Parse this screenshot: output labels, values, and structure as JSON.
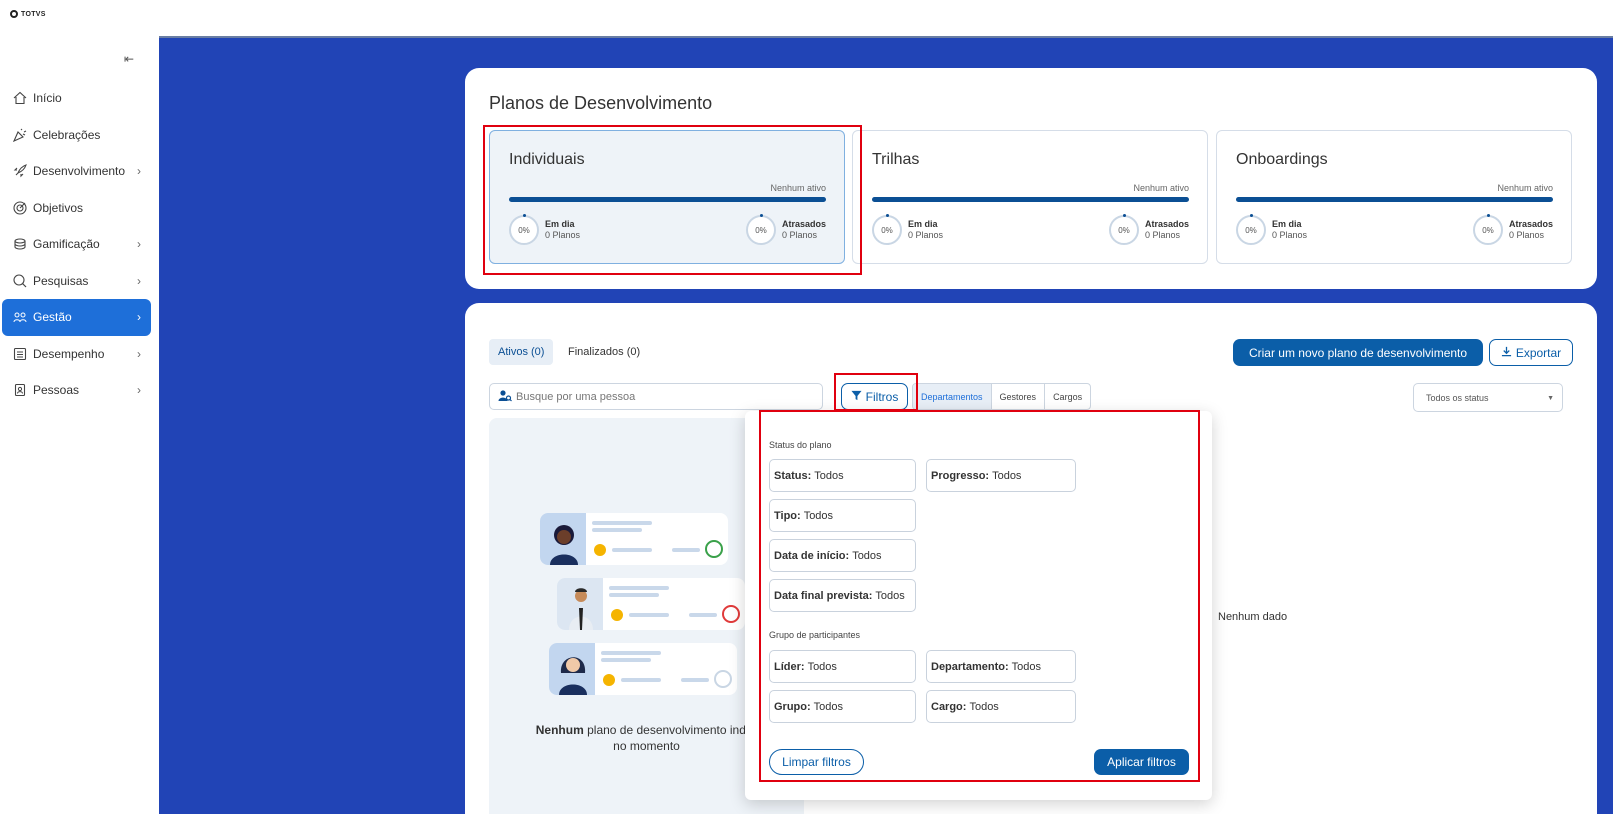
{
  "logo": {
    "text": "TOTVS"
  },
  "sidebar": {
    "collapse_icon": "collapse-left-icon",
    "items": [
      {
        "label": "Início",
        "icon": "home-icon",
        "has_chevron": false,
        "active": false
      },
      {
        "label": "Celebrações",
        "icon": "party-icon",
        "has_chevron": false,
        "active": false
      },
      {
        "label": "Desenvolvimento",
        "icon": "rocket-icon",
        "has_chevron": true,
        "active": false
      },
      {
        "label": "Objetivos",
        "icon": "target-icon",
        "has_chevron": false,
        "active": false
      },
      {
        "label": "Gamificação",
        "icon": "coins-icon",
        "has_chevron": true,
        "active": false
      },
      {
        "label": "Pesquisas",
        "icon": "search-survey-icon",
        "has_chevron": true,
        "active": false
      },
      {
        "label": "Gestão",
        "icon": "team-icon",
        "has_chevron": true,
        "active": true
      },
      {
        "label": "Desempenho",
        "icon": "checklist-icon",
        "has_chevron": true,
        "active": false
      },
      {
        "label": "Pessoas",
        "icon": "badge-icon",
        "has_chevron": true,
        "active": false
      }
    ]
  },
  "summary": {
    "title": "Planos de Desenvolvimento",
    "cards": [
      {
        "title": "Individuais",
        "note": "Nenhum ativo",
        "left": {
          "pct": "0%",
          "label": "Em dia",
          "sub": "0 Planos"
        },
        "right": {
          "pct": "0%",
          "label": "Atrasados",
          "sub": "0 Planos"
        }
      },
      {
        "title": "Trilhas",
        "note": "Nenhum ativo",
        "left": {
          "pct": "0%",
          "label": "Em dia",
          "sub": "0 Planos"
        },
        "right": {
          "pct": "0%",
          "label": "Atrasados",
          "sub": "0 Planos"
        }
      },
      {
        "title": "Onboardings",
        "note": "Nenhum ativo",
        "left": {
          "pct": "0%",
          "label": "Em dia",
          "sub": "0 Planos"
        },
        "right": {
          "pct": "0%",
          "label": "Atrasados",
          "sub": "0 Planos"
        }
      }
    ]
  },
  "list": {
    "tabs": [
      {
        "label": "Ativos (0)"
      },
      {
        "label": "Finalizados (0)"
      }
    ],
    "create_button": "Criar um novo plano de desenvolvimento",
    "export_button": "Exportar",
    "search_placeholder": "Busque por uma pessoa",
    "filters_button": "Filtros",
    "segments": [
      {
        "label": "Departamentos"
      },
      {
        "label": "Gestores"
      },
      {
        "label": "Cargos"
      }
    ],
    "status_select": "Todos os status",
    "empty_bold": "Nenhum",
    "empty_rest": "plano de desenvolvimento indivi",
    "empty_line2": "no momento",
    "no_data": "Nenhum dado"
  },
  "filters": {
    "section1": "Status do plano",
    "section2": "Grupo de participantes",
    "chips": {
      "status": {
        "label": "Status:",
        "value": "Todos"
      },
      "progresso": {
        "label": "Progresso:",
        "value": "Todos"
      },
      "tipo": {
        "label": "Tipo:",
        "value": "Todos"
      },
      "data_inicio": {
        "label": "Data de início:",
        "value": "Todos"
      },
      "data_final": {
        "label": "Data final prevista:",
        "value": "Todos"
      },
      "lider": {
        "label": "Líder:",
        "value": "Todos"
      },
      "departamento": {
        "label": "Departamento:",
        "value": "Todos"
      },
      "grupo": {
        "label": "Grupo:",
        "value": "Todos"
      },
      "cargo": {
        "label": "Cargo:",
        "value": "Todos"
      }
    },
    "clear_button": "Limpar filtros",
    "apply_button": "Aplicar filtros"
  },
  "colors": {
    "accent": "#0b5ea8",
    "sidebar_active": "#1e6fd9",
    "background": "#2144b6",
    "highlight": "#e0000f"
  }
}
